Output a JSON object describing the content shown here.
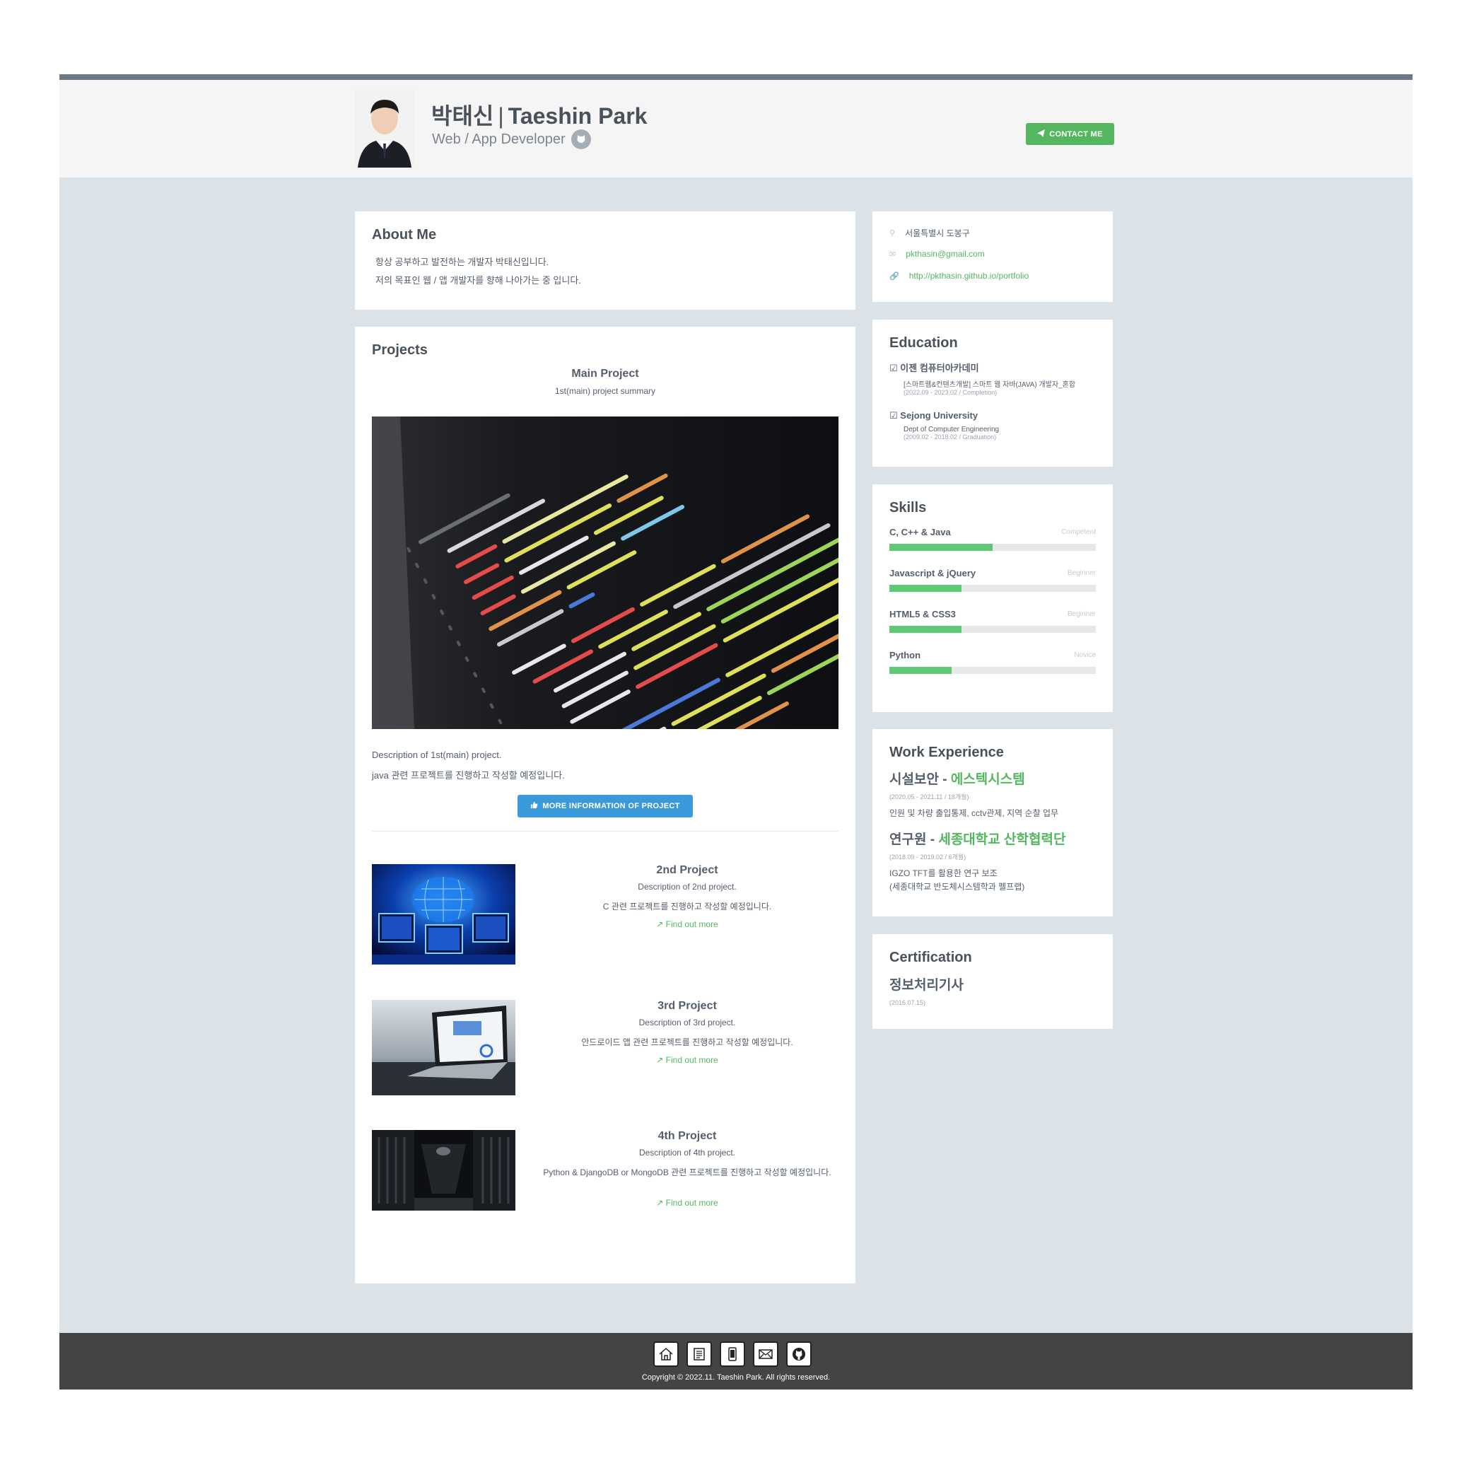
{
  "header": {
    "name_ko": "박태신",
    "name_separator": "|",
    "name_en": "Taeshin Park",
    "tagline": "Web / App Developer",
    "contact_label": "CONTACT ME"
  },
  "about": {
    "title": "About Me",
    "line1": "항상 공부하고 발전하는 개발자 박태신입니다.",
    "line2": "저의 목표인 웹 / 앱 개발자를 향해 나아가는 중 입니다."
  },
  "projects": {
    "title": "Projects",
    "main": {
      "title": "Main Project",
      "summary": "1st(main) project summary",
      "desc1": "Description of 1st(main) project.",
      "desc2": "java 관련 프로젝트를 진행하고 작성할 예정입니다.",
      "button_label": "MORE INFORMATION OF PROJECT"
    },
    "items": [
      {
        "title": "2nd Project",
        "desc": "Description of 2nd project.",
        "detail": "C 관련 프로젝트를 진행하고 작성할 예정입니다.",
        "link": "Find out more"
      },
      {
        "title": "3rd Project",
        "desc": "Description of 3rd project.",
        "detail": "안드로이드 앱 관련 프로젝트를 진행하고 작성할 예정입니다.",
        "link": "Find out more"
      },
      {
        "title": "4th Project",
        "desc": "Description of 4th project.",
        "detail": "Python & DjangoDB or MongoDB 관련 프로젝트를 진행하고 작성할 예정입니다.",
        "link": "Find out more"
      }
    ]
  },
  "contact_info": {
    "location": "서울특별시 도봉구",
    "email": "pkthasin@gmail.com",
    "website": "http://pkthasin.github.io/portfolio"
  },
  "education": {
    "title": "Education",
    "items": [
      {
        "school": "이젠 컴퓨터아카데미",
        "program": "[스마트웹&컨텐츠개발] 스마트 웹 자바(JAVA) 개발자_혼합",
        "period": "(2022.09 - 2023.02 / Completion)"
      },
      {
        "school": "Sejong University",
        "program": "Dept of Computer Engineering",
        "period": "(2009.02 - 2018.02 / Graduation)"
      }
    ]
  },
  "skills": {
    "title": "Skills",
    "items": [
      {
        "name": "C, C++ & Java",
        "level": "Competent",
        "progress": 0.5
      },
      {
        "name": "Javascript & jQuery",
        "level": "Beginner",
        "progress": 0.35
      },
      {
        "name": "HTML5 & CSS3",
        "level": "Beginner",
        "progress": 0.35
      },
      {
        "name": "Python",
        "level": "Novice",
        "progress": 0.3
      }
    ]
  },
  "work": {
    "title": "Work Experience",
    "items": [
      {
        "role": "시설보안",
        "dash": "-",
        "company": "에스텍시스템",
        "period": "(2020.05 - 2021.11 / 18개월)",
        "desc1": "인원 및 차량 출입통제, cctv관제, 지역 순찰 업무",
        "desc2": ""
      },
      {
        "role": "연구원",
        "dash": "-",
        "company": "세종대학교 산학협력단",
        "period": "(2018.09 - 2019.02 / 6개월)",
        "desc1": "IGZO TFT를 활용한 연구 보조",
        "desc2": "(세종대학교 반도체시스템학과 펠프랩)"
      }
    ]
  },
  "certification": {
    "title": "Certification",
    "name": "정보처리기사",
    "date": "(2016.07.15)"
  },
  "footer": {
    "icons": [
      "home-icon",
      "document-icon",
      "mobile-icon",
      "mail-icon",
      "github-icon"
    ],
    "copyright": "Copyright © 2022.11. Taeshin Park. All rights reserved."
  },
  "colors": {
    "accent_green": "#54b75f",
    "button_blue": "#3a9ad9",
    "page_background": "#dbe2e8",
    "footer_background": "#444444"
  }
}
